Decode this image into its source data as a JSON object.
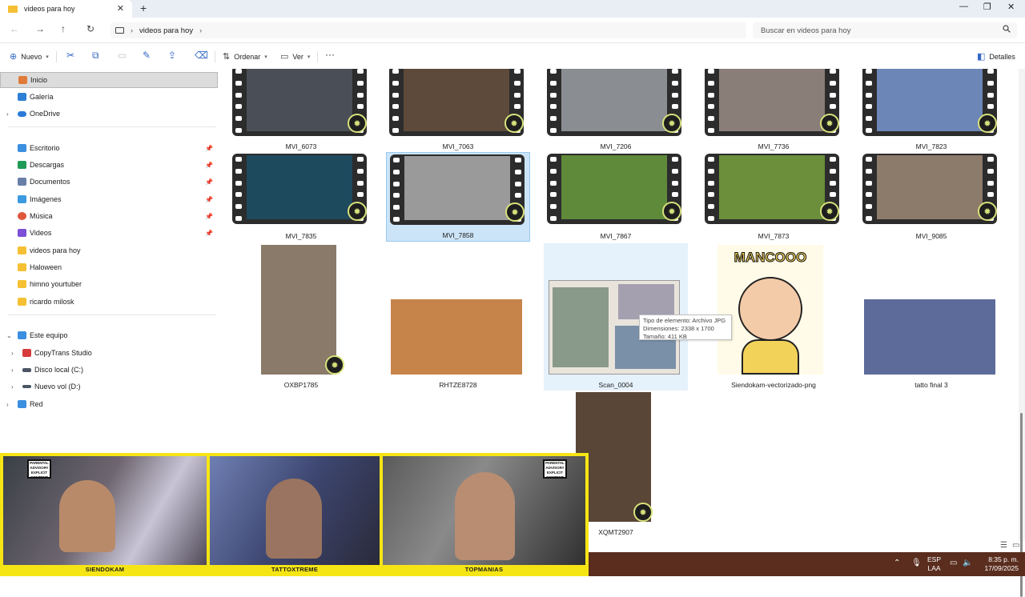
{
  "window": {
    "tab_title": "videos para hoy",
    "tab_close": "✕",
    "new_tab": "+",
    "minimize": "—",
    "maximize": "❐",
    "close": "✕"
  },
  "address": {
    "back": "←",
    "forward": "→",
    "up": "↑",
    "refresh": "↻",
    "chevron": "›",
    "crumb": "videos para hoy",
    "search_placeholder": "Buscar en videos para hoy",
    "search_icon": "search-icon"
  },
  "toolbar": {
    "new_label": "Nuevo",
    "sort_label": "Ordenar",
    "view_label": "Ver",
    "more": "···",
    "details_label": "Detalles",
    "cut": "✂",
    "copy": "⧉",
    "paste": "📋",
    "rename": "✎",
    "share": "⇪",
    "delete": "🗑"
  },
  "sidebar": {
    "items": [
      {
        "label": "Inicio",
        "icon": "home-icon",
        "color": "#e07b39"
      },
      {
        "label": "Galería",
        "icon": "gallery-icon",
        "color": "#2e7fd6"
      },
      {
        "label": "OneDrive",
        "icon": "cloud-icon",
        "color": "#2a7bd8"
      },
      {
        "label": "Escritorio",
        "icon": "desktop-icon",
        "color": "#3a8fe0"
      },
      {
        "label": "Descargas",
        "icon": "download-icon",
        "color": "#1f9b57"
      },
      {
        "label": "Documentos",
        "icon": "document-icon",
        "color": "#6a7ea8"
      },
      {
        "label": "Imágenes",
        "icon": "pictures-icon",
        "color": "#3b9ae0"
      },
      {
        "label": "Música",
        "icon": "music-icon",
        "color": "#e0583b"
      },
      {
        "label": "Videos",
        "icon": "video-icon",
        "color": "#7b4fd6"
      },
      {
        "label": "videos para hoy",
        "icon": "folder-icon",
        "color": "#f5c033"
      },
      {
        "label": "Haloween",
        "icon": "folder-icon",
        "color": "#f5c033"
      },
      {
        "label": "himno yourtuber",
        "icon": "folder-icon",
        "color": "#f5c033"
      },
      {
        "label": "ricardo milosk",
        "icon": "folder-icon",
        "color": "#f5c033"
      },
      {
        "label": "Este equipo",
        "icon": "computer-icon",
        "color": "#3a8fe0"
      },
      {
        "label": "CopyTrans Studio",
        "icon": "app-icon",
        "color": "#d63b3b"
      },
      {
        "label": "Disco local (C:)",
        "icon": "drive-icon",
        "color": "#4b5563"
      },
      {
        "label": "Nuevo vol (D:)",
        "icon": "drive-icon",
        "color": "#4b5563"
      },
      {
        "label": "Red",
        "icon": "network-icon",
        "color": "#3a8fe0"
      }
    ]
  },
  "files": [
    {
      "name": "MVI_6073",
      "kind": "video",
      "color": "#4a4f57"
    },
    {
      "name": "MVI_7063",
      "kind": "video",
      "color": "#5d4a3a"
    },
    {
      "name": "MVI_7206",
      "kind": "video",
      "color": "#8a8d92"
    },
    {
      "name": "MVI_7736",
      "kind": "video",
      "color": "#8a7f78"
    },
    {
      "name": "MVI_7823",
      "kind": "video",
      "color": "#6d86b8"
    },
    {
      "name": "MVI_7835",
      "kind": "video",
      "color": "#1e4a5e"
    },
    {
      "name": "MVI_7858",
      "kind": "video",
      "color": "#9a9a9a"
    },
    {
      "name": "MVI_7867",
      "kind": "video",
      "color": "#5f8a3a"
    },
    {
      "name": "MVI_7873",
      "kind": "video",
      "color": "#6b8f3b"
    },
    {
      "name": "MVI_9085",
      "kind": "video",
      "color": "#8c7a6a"
    },
    {
      "name": "OXBP1785",
      "kind": "video-portrait",
      "color": "#8a7a6a"
    },
    {
      "name": "RHTZE8728",
      "kind": "photo",
      "color": "#c6844a"
    },
    {
      "name": "Scan_0004",
      "kind": "photo",
      "color": "#e8e4dc"
    },
    {
      "name": "Siendokam-vectorizado-png",
      "kind": "photo",
      "color": "#f3d25a"
    },
    {
      "name": "tatto final 3",
      "kind": "photo",
      "color": "#5c6b9a"
    },
    {
      "name": "XQMT2907",
      "kind": "video-portrait",
      "color": "#5a4636"
    }
  ],
  "cartoon_text": "MANCOOO",
  "tooltip": {
    "type": "Tipo de elemento: Archivo JPG",
    "dims": "Dimensiones: 2338 x 1700",
    "size": "Tamaño: 411 KB"
  },
  "webcam": {
    "names": [
      "SIENDOKAM",
      "TATTOXTREME",
      "TOPMANIAS"
    ],
    "advisory": "PARENTAL ADVISORY EXPLICIT CONTENT"
  },
  "taskbar": {
    "lang_top": "ESP",
    "lang_bottom": "LAA",
    "time": "8:35 p. m.",
    "date": "17/09/2025"
  }
}
